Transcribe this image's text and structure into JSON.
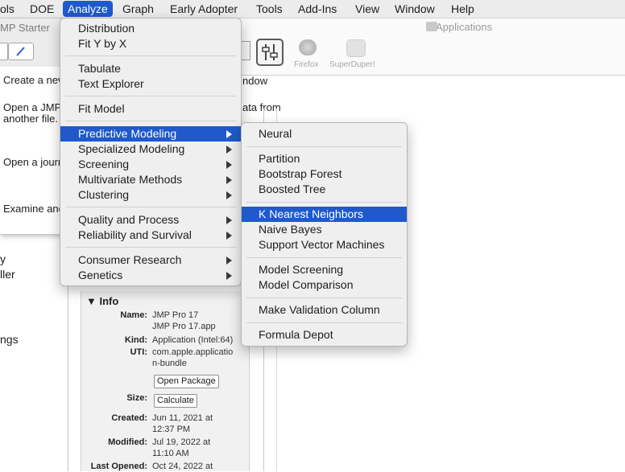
{
  "menubar": {
    "items": [
      "ols",
      "DOE",
      "Analyze",
      "Graph",
      "Early Adopter",
      "Tools",
      "Add-Ins",
      "View",
      "Window",
      "Help"
    ],
    "active": "Analyze"
  },
  "starter": {
    "title": "MP Starter",
    "lines": [
      "Create a nev",
      "Open a JMP",
      "another file.",
      "Open a journ",
      "Examine and"
    ]
  },
  "left_fragments": [
    "y",
    "ller",
    "ngs"
  ],
  "finder": {
    "title": "Applications",
    "toolbar_apps": [
      "Firefox",
      "SuperDuper!"
    ],
    "behind_text": [
      "ndow",
      "ata from"
    ]
  },
  "analyze_menu": {
    "items": [
      {
        "label": "Distribution"
      },
      {
        "label": "Fit Y by X"
      },
      {
        "label": "Tabulate"
      },
      {
        "label": "Text Explorer"
      },
      {
        "label": "Fit Model"
      },
      {
        "label": "Predictive Modeling",
        "submenu": true,
        "highlighted": true
      },
      {
        "label": "Specialized Modeling",
        "submenu": true
      },
      {
        "label": "Screening",
        "submenu": true
      },
      {
        "label": "Multivariate Methods",
        "submenu": true
      },
      {
        "label": "Clustering",
        "submenu": true
      },
      {
        "label": "Quality and Process",
        "submenu": true
      },
      {
        "label": "Reliability and Survival",
        "submenu": true
      },
      {
        "label": "Consumer Research",
        "submenu": true
      },
      {
        "label": "Genetics",
        "submenu": true
      }
    ]
  },
  "predictive_menu": {
    "items": [
      {
        "label": "Neural"
      },
      {
        "label": "Partition"
      },
      {
        "label": "Bootstrap Forest"
      },
      {
        "label": "Boosted Tree"
      },
      {
        "label": "K Nearest Neighbors",
        "highlighted": true
      },
      {
        "label": "Naive Bayes"
      },
      {
        "label": "Support Vector Machines"
      },
      {
        "label": "Model Screening"
      },
      {
        "label": "Model Comparison"
      },
      {
        "label": "Make Validation Column"
      },
      {
        "label": "Formula Depot"
      }
    ]
  },
  "info": {
    "heading": "Info",
    "name_label": "Name:",
    "name_value_1": "JMP Pro 17",
    "name_value_2": "JMP Pro 17.app",
    "kind_label": "Kind:",
    "kind_value": "Application (Intel:64)",
    "uti_label": "UTI:",
    "uti_value_1": "com.apple.applicatio",
    "uti_value_2": "n-bundle",
    "open_package": "Open Package",
    "size_label": "Size:",
    "calculate": "Calculate",
    "created_label": "Created:",
    "created_1": "Jun 11, 2021 at",
    "created_2": "12:37 PM",
    "modified_label": "Modified:",
    "modified_1": "Jul 19, 2022 at",
    "modified_2": "11:10 AM",
    "last_opened_label": "Last Opened:",
    "last_opened_1": "Oct 24, 2022 at"
  },
  "colors": {
    "highlight": "#1f59cc",
    "menu_bg": "#efefef"
  }
}
